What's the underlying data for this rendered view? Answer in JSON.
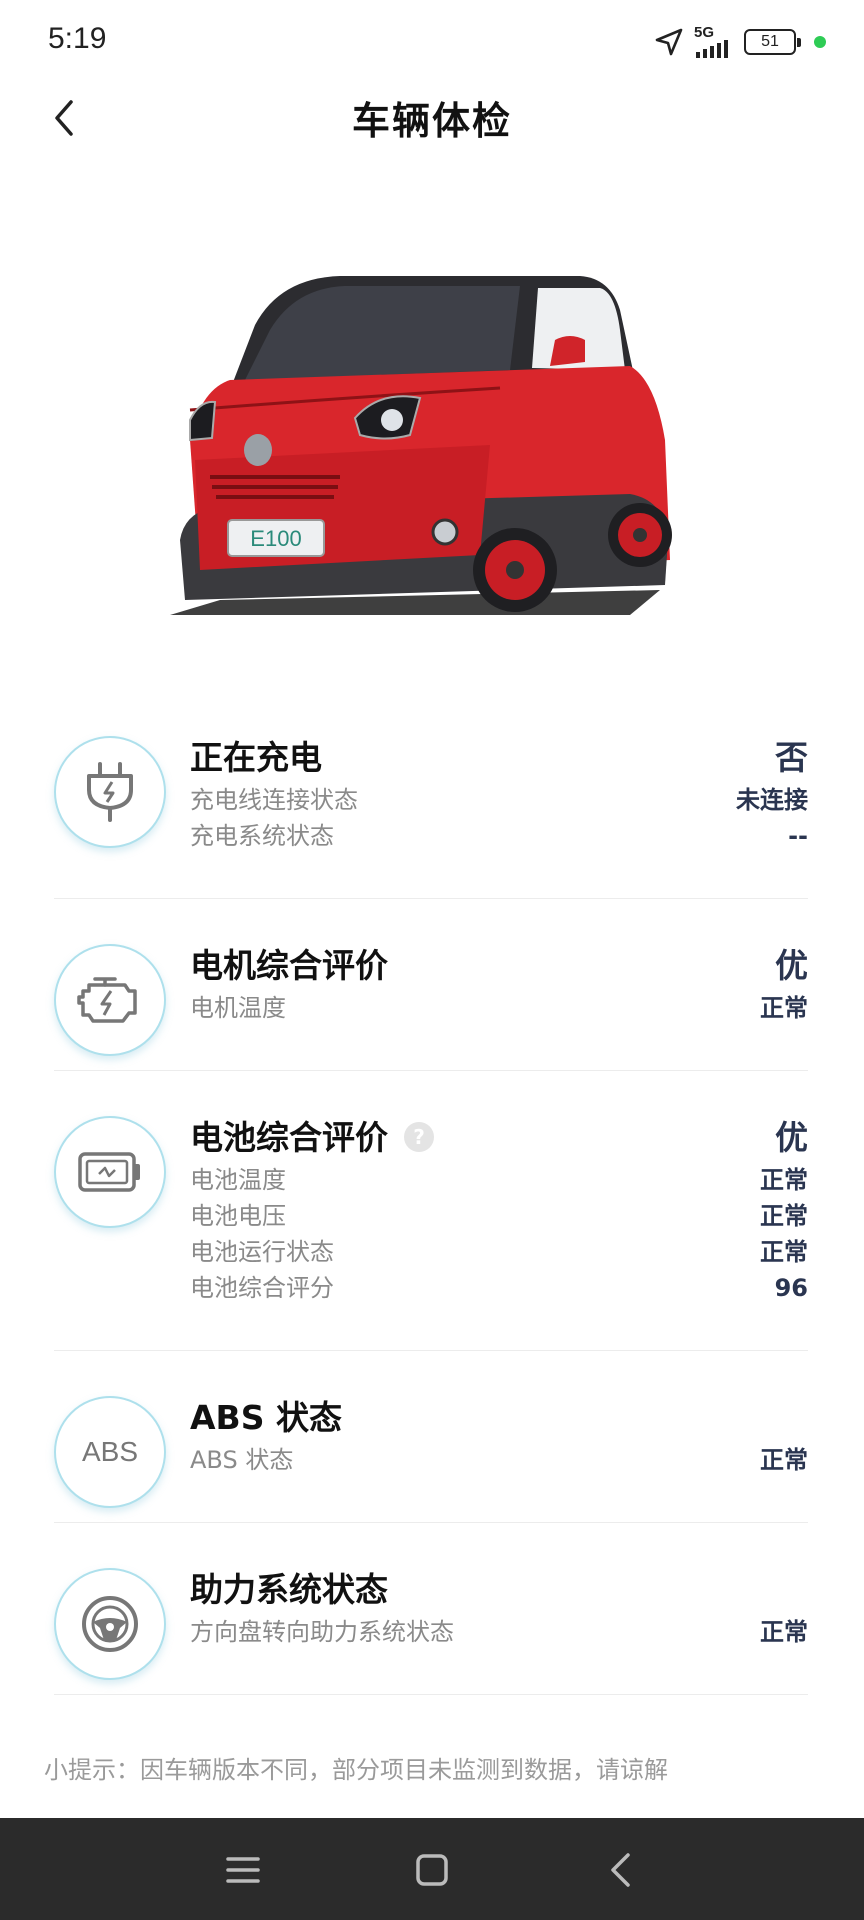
{
  "status_bar": {
    "time": "5:19",
    "network": "5G",
    "battery": "51"
  },
  "header": {
    "title": "车辆体检",
    "back_icon": "chevron-left-icon"
  },
  "checks": {
    "charging": {
      "icon": "plug-icon",
      "title": "正在充电",
      "value": "否",
      "items": [
        {
          "label": "充电线连接状态",
          "value": "未连接"
        },
        {
          "label": "充电系统状态",
          "value": "--"
        }
      ]
    },
    "motor": {
      "icon": "engine-icon",
      "title": "电机综合评价",
      "value": "优",
      "items": [
        {
          "label": "电机温度",
          "value": "正常"
        }
      ]
    },
    "battery": {
      "icon": "battery-icon",
      "title": "电池综合评价",
      "help": "?",
      "value": "优",
      "items": [
        {
          "label": "电池温度",
          "value": "正常"
        },
        {
          "label": "电池电压",
          "value": "正常"
        },
        {
          "label": "电池运行状态",
          "value": "正常"
        },
        {
          "label": "电池综合评分",
          "value": "96"
        }
      ]
    },
    "abs": {
      "icon_text": "ABS",
      "title": "ABS 状态",
      "items": [
        {
          "label": "ABS 状态",
          "value": "正常"
        }
      ]
    },
    "steering": {
      "icon": "steering-wheel-icon",
      "title": "助力系统状态",
      "items": [
        {
          "label": "方向盘转向助力系统状态",
          "value": "正常"
        }
      ]
    }
  },
  "car_image": {
    "plate_text": "E100",
    "body_color": "#d9262c"
  },
  "tip": "小提示：因车辆版本不同，部分项目未监测到数据，请谅解",
  "nav": {
    "menu_icon": "menu-icon",
    "home_icon": "home-square-icon",
    "back_icon": "back-triangle-icon"
  }
}
